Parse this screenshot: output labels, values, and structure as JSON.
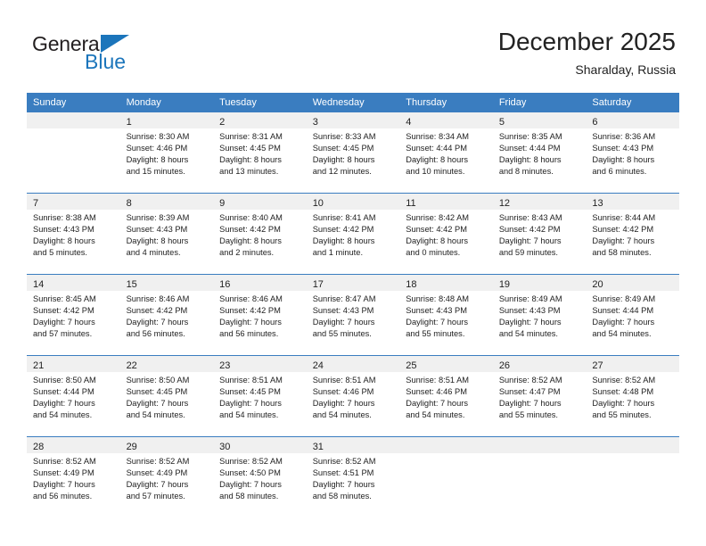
{
  "brand": {
    "name_part1": "General",
    "name_part2": "Blue",
    "triangle_color": "#1b75bb"
  },
  "header": {
    "title": "December 2025",
    "subtitle": "Sharalday, Russia"
  },
  "theme": {
    "header_bg": "#3a7dc0",
    "daynum_band_bg": "#f0f0f0",
    "grid_line": "#3a7dc0",
    "text": "#222222"
  },
  "weekday_headers": [
    "Sunday",
    "Monday",
    "Tuesday",
    "Wednesday",
    "Thursday",
    "Friday",
    "Saturday"
  ],
  "weeks": [
    [
      {
        "day": "",
        "sunrise": "",
        "sunset": "",
        "daylight_line1": "",
        "daylight_line2": ""
      },
      {
        "day": "1",
        "sunrise": "Sunrise: 8:30 AM",
        "sunset": "Sunset: 4:46 PM",
        "daylight_line1": "Daylight: 8 hours",
        "daylight_line2": "and 15 minutes."
      },
      {
        "day": "2",
        "sunrise": "Sunrise: 8:31 AM",
        "sunset": "Sunset: 4:45 PM",
        "daylight_line1": "Daylight: 8 hours",
        "daylight_line2": "and 13 minutes."
      },
      {
        "day": "3",
        "sunrise": "Sunrise: 8:33 AM",
        "sunset": "Sunset: 4:45 PM",
        "daylight_line1": "Daylight: 8 hours",
        "daylight_line2": "and 12 minutes."
      },
      {
        "day": "4",
        "sunrise": "Sunrise: 8:34 AM",
        "sunset": "Sunset: 4:44 PM",
        "daylight_line1": "Daylight: 8 hours",
        "daylight_line2": "and 10 minutes."
      },
      {
        "day": "5",
        "sunrise": "Sunrise: 8:35 AM",
        "sunset": "Sunset: 4:44 PM",
        "daylight_line1": "Daylight: 8 hours",
        "daylight_line2": "and 8 minutes."
      },
      {
        "day": "6",
        "sunrise": "Sunrise: 8:36 AM",
        "sunset": "Sunset: 4:43 PM",
        "daylight_line1": "Daylight: 8 hours",
        "daylight_line2": "and 6 minutes."
      }
    ],
    [
      {
        "day": "7",
        "sunrise": "Sunrise: 8:38 AM",
        "sunset": "Sunset: 4:43 PM",
        "daylight_line1": "Daylight: 8 hours",
        "daylight_line2": "and 5 minutes."
      },
      {
        "day": "8",
        "sunrise": "Sunrise: 8:39 AM",
        "sunset": "Sunset: 4:43 PM",
        "daylight_line1": "Daylight: 8 hours",
        "daylight_line2": "and 4 minutes."
      },
      {
        "day": "9",
        "sunrise": "Sunrise: 8:40 AM",
        "sunset": "Sunset: 4:42 PM",
        "daylight_line1": "Daylight: 8 hours",
        "daylight_line2": "and 2 minutes."
      },
      {
        "day": "10",
        "sunrise": "Sunrise: 8:41 AM",
        "sunset": "Sunset: 4:42 PM",
        "daylight_line1": "Daylight: 8 hours",
        "daylight_line2": "and 1 minute."
      },
      {
        "day": "11",
        "sunrise": "Sunrise: 8:42 AM",
        "sunset": "Sunset: 4:42 PM",
        "daylight_line1": "Daylight: 8 hours",
        "daylight_line2": "and 0 minutes."
      },
      {
        "day": "12",
        "sunrise": "Sunrise: 8:43 AM",
        "sunset": "Sunset: 4:42 PM",
        "daylight_line1": "Daylight: 7 hours",
        "daylight_line2": "and 59 minutes."
      },
      {
        "day": "13",
        "sunrise": "Sunrise: 8:44 AM",
        "sunset": "Sunset: 4:42 PM",
        "daylight_line1": "Daylight: 7 hours",
        "daylight_line2": "and 58 minutes."
      }
    ],
    [
      {
        "day": "14",
        "sunrise": "Sunrise: 8:45 AM",
        "sunset": "Sunset: 4:42 PM",
        "daylight_line1": "Daylight: 7 hours",
        "daylight_line2": "and 57 minutes."
      },
      {
        "day": "15",
        "sunrise": "Sunrise: 8:46 AM",
        "sunset": "Sunset: 4:42 PM",
        "daylight_line1": "Daylight: 7 hours",
        "daylight_line2": "and 56 minutes."
      },
      {
        "day": "16",
        "sunrise": "Sunrise: 8:46 AM",
        "sunset": "Sunset: 4:42 PM",
        "daylight_line1": "Daylight: 7 hours",
        "daylight_line2": "and 56 minutes."
      },
      {
        "day": "17",
        "sunrise": "Sunrise: 8:47 AM",
        "sunset": "Sunset: 4:43 PM",
        "daylight_line1": "Daylight: 7 hours",
        "daylight_line2": "and 55 minutes."
      },
      {
        "day": "18",
        "sunrise": "Sunrise: 8:48 AM",
        "sunset": "Sunset: 4:43 PM",
        "daylight_line1": "Daylight: 7 hours",
        "daylight_line2": "and 55 minutes."
      },
      {
        "day": "19",
        "sunrise": "Sunrise: 8:49 AM",
        "sunset": "Sunset: 4:43 PM",
        "daylight_line1": "Daylight: 7 hours",
        "daylight_line2": "and 54 minutes."
      },
      {
        "day": "20",
        "sunrise": "Sunrise: 8:49 AM",
        "sunset": "Sunset: 4:44 PM",
        "daylight_line1": "Daylight: 7 hours",
        "daylight_line2": "and 54 minutes."
      }
    ],
    [
      {
        "day": "21",
        "sunrise": "Sunrise: 8:50 AM",
        "sunset": "Sunset: 4:44 PM",
        "daylight_line1": "Daylight: 7 hours",
        "daylight_line2": "and 54 minutes."
      },
      {
        "day": "22",
        "sunrise": "Sunrise: 8:50 AM",
        "sunset": "Sunset: 4:45 PM",
        "daylight_line1": "Daylight: 7 hours",
        "daylight_line2": "and 54 minutes."
      },
      {
        "day": "23",
        "sunrise": "Sunrise: 8:51 AM",
        "sunset": "Sunset: 4:45 PM",
        "daylight_line1": "Daylight: 7 hours",
        "daylight_line2": "and 54 minutes."
      },
      {
        "day": "24",
        "sunrise": "Sunrise: 8:51 AM",
        "sunset": "Sunset: 4:46 PM",
        "daylight_line1": "Daylight: 7 hours",
        "daylight_line2": "and 54 minutes."
      },
      {
        "day": "25",
        "sunrise": "Sunrise: 8:51 AM",
        "sunset": "Sunset: 4:46 PM",
        "daylight_line1": "Daylight: 7 hours",
        "daylight_line2": "and 54 minutes."
      },
      {
        "day": "26",
        "sunrise": "Sunrise: 8:52 AM",
        "sunset": "Sunset: 4:47 PM",
        "daylight_line1": "Daylight: 7 hours",
        "daylight_line2": "and 55 minutes."
      },
      {
        "day": "27",
        "sunrise": "Sunrise: 8:52 AM",
        "sunset": "Sunset: 4:48 PM",
        "daylight_line1": "Daylight: 7 hours",
        "daylight_line2": "and 55 minutes."
      }
    ],
    [
      {
        "day": "28",
        "sunrise": "Sunrise: 8:52 AM",
        "sunset": "Sunset: 4:49 PM",
        "daylight_line1": "Daylight: 7 hours",
        "daylight_line2": "and 56 minutes."
      },
      {
        "day": "29",
        "sunrise": "Sunrise: 8:52 AM",
        "sunset": "Sunset: 4:49 PM",
        "daylight_line1": "Daylight: 7 hours",
        "daylight_line2": "and 57 minutes."
      },
      {
        "day": "30",
        "sunrise": "Sunrise: 8:52 AM",
        "sunset": "Sunset: 4:50 PM",
        "daylight_line1": "Daylight: 7 hours",
        "daylight_line2": "and 58 minutes."
      },
      {
        "day": "31",
        "sunrise": "Sunrise: 8:52 AM",
        "sunset": "Sunset: 4:51 PM",
        "daylight_line1": "Daylight: 7 hours",
        "daylight_line2": "and 58 minutes."
      },
      {
        "day": "",
        "sunrise": "",
        "sunset": "",
        "daylight_line1": "",
        "daylight_line2": ""
      },
      {
        "day": "",
        "sunrise": "",
        "sunset": "",
        "daylight_line1": "",
        "daylight_line2": ""
      },
      {
        "day": "",
        "sunrise": "",
        "sunset": "",
        "daylight_line1": "",
        "daylight_line2": ""
      }
    ]
  ]
}
